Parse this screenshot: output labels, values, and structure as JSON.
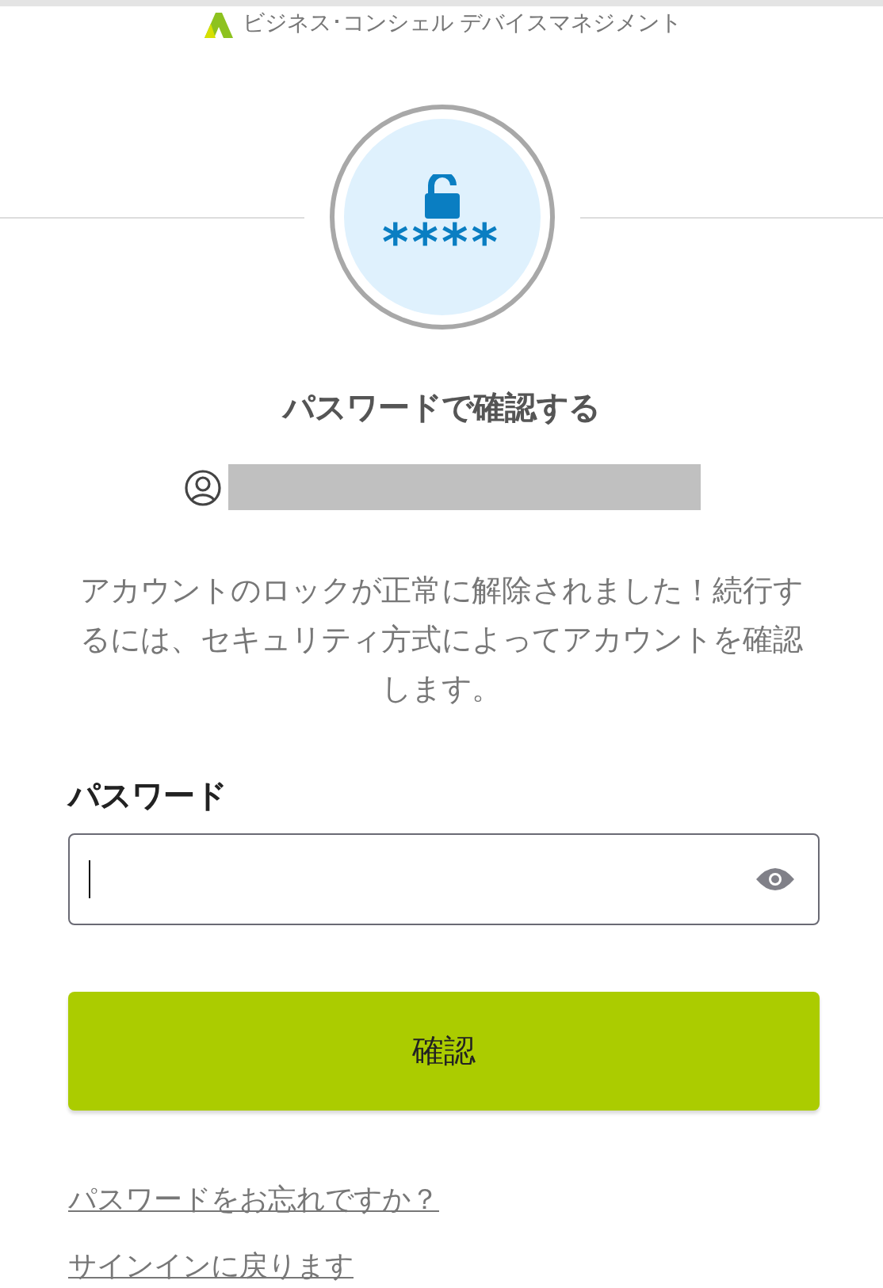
{
  "header": {
    "brand": "ビジネス･コンシェル デバイスマネジメント"
  },
  "badge": {
    "mask": "****"
  },
  "title": "パスワードで確認する",
  "account": {
    "redacted": true
  },
  "message": "アカウントのロックが正常に解除されました！続行するには、セキュリティ方式によってアカウントを確認します。",
  "password": {
    "label": "パスワード",
    "focused": true
  },
  "submit": {
    "label": "確認"
  },
  "links": [
    "パスワードをお忘れですか？",
    "サインインに戻ります"
  ]
}
